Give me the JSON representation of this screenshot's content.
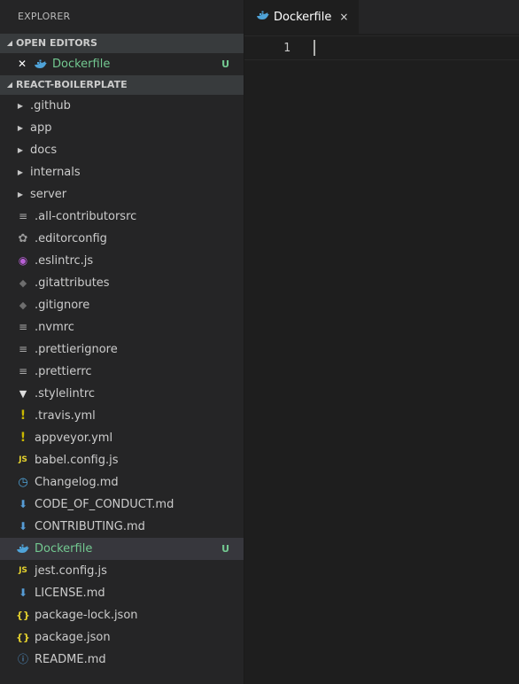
{
  "explorer": {
    "title": "EXPLORER",
    "open_editors": {
      "header": "OPEN EDITORS",
      "items": [
        {
          "label": "Dockerfile",
          "icon": "docker-icon",
          "status": "U"
        }
      ]
    },
    "project": {
      "header": "REACT-BOILERPLATE",
      "folders": [
        {
          "label": ".github"
        },
        {
          "label": "app"
        },
        {
          "label": "docs"
        },
        {
          "label": "internals"
        },
        {
          "label": "server"
        }
      ],
      "files": [
        {
          "label": ".all-contributorsrc",
          "icon": "lines-icon"
        },
        {
          "label": ".editorconfig",
          "icon": "gear-icon"
        },
        {
          "label": ".eslintrc.js",
          "icon": "eslint-icon"
        },
        {
          "label": ".gitattributes",
          "icon": "git-icon"
        },
        {
          "label": ".gitignore",
          "icon": "git-icon"
        },
        {
          "label": ".nvmrc",
          "icon": "lines-icon"
        },
        {
          "label": ".prettierignore",
          "icon": "lines-icon"
        },
        {
          "label": ".prettierrc",
          "icon": "lines-icon"
        },
        {
          "label": ".stylelintrc",
          "icon": "stylelint-icon"
        },
        {
          "label": ".travis.yml",
          "icon": "yml-icon"
        },
        {
          "label": "appveyor.yml",
          "icon": "yml-icon"
        },
        {
          "label": "babel.config.js",
          "icon": "js-icon",
          "icon_text": "JS"
        },
        {
          "label": "Changelog.md",
          "icon": "clock-icon"
        },
        {
          "label": "CODE_OF_CONDUCT.md",
          "icon": "markdown-icon"
        },
        {
          "label": "CONTRIBUTING.md",
          "icon": "markdown-icon"
        },
        {
          "label": "Dockerfile",
          "icon": "docker-icon",
          "status": "U"
        },
        {
          "label": "jest.config.js",
          "icon": "js-icon",
          "icon_text": "JS"
        },
        {
          "label": "LICENSE.md",
          "icon": "markdown-icon"
        },
        {
          "label": "package-lock.json",
          "icon": "json-icon",
          "icon_text": "{}"
        },
        {
          "label": "package.json",
          "icon": "json-icon",
          "icon_text": "{}"
        },
        {
          "label": "README.md",
          "icon": "info-icon"
        }
      ]
    }
  },
  "editor": {
    "tab": {
      "label": "Dockerfile",
      "close": "×"
    },
    "line_number": "1"
  },
  "colors": {
    "untracked": "#73c991",
    "docker": "#4fa3d8",
    "selected_row": "#37373d"
  }
}
